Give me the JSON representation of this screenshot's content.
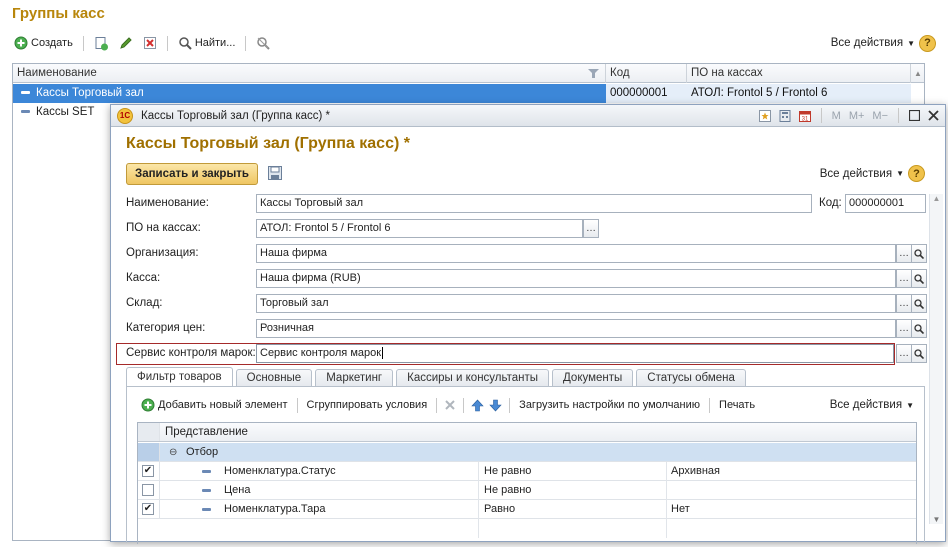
{
  "list_window": {
    "title": "Группы касс",
    "toolbar": {
      "create_label": "Создать",
      "find_label": "Найти...",
      "all_actions": "Все действия"
    },
    "columns": [
      "Наименование",
      "Код",
      "ПО на кассах"
    ],
    "rows": [
      {
        "name": "Кассы Торговый зал",
        "code": "000000001",
        "po": "АТОЛ: Frontol 5 / Frontol 6"
      },
      {
        "name": "Кассы SET",
        "code": "",
        "po": ""
      }
    ]
  },
  "form_window": {
    "window_title": "Кассы Торговый зал (Группа касс) *",
    "titlebar_buttons": [
      "M",
      "M+",
      "M−"
    ],
    "heading": "Кассы Торговый зал (Группа касс) *",
    "save_close_label": "Записать и закрыть",
    "all_actions": "Все действия",
    "fields": {
      "name": {
        "label": "Наименование:",
        "value": "Кассы Торговый зал"
      },
      "code": {
        "label": "Код:",
        "value": "000000001"
      },
      "po": {
        "label": "ПО на кассах:",
        "value": "АТОЛ: Frontol 5 / Frontol 6"
      },
      "org": {
        "label": "Организация:",
        "value": "Наша фирма"
      },
      "kassa": {
        "label": "Касса:",
        "value": "Наша фирма (RUB)"
      },
      "sklad": {
        "label": "Склад:",
        "value": "Торговый зал"
      },
      "price_cat": {
        "label": "Категория цен:",
        "value": "Розничная"
      },
      "mark_service": {
        "label": "Сервис контроля марок:",
        "value": "Сервис контроля марок"
      }
    },
    "tabs": [
      "Фильтр товаров",
      "Основные",
      "Маркетинг",
      "Кассиры и консультанты",
      "Документы",
      "Статусы обмена"
    ],
    "filter_toolbar": {
      "add_label": "Добавить новый элемент",
      "group_label": "Сгруппировать условия",
      "load_label": "Загрузить настройки по умолчанию",
      "print_label": "Печать",
      "all_actions": "Все действия"
    },
    "filter_grid": {
      "header": "Представление",
      "group_label": "Отбор",
      "rows": [
        {
          "checked": true,
          "field": "Номенклатура.Статус",
          "op": "Не равно",
          "value": "Архивная"
        },
        {
          "checked": false,
          "field": "Цена",
          "op": "Не равно",
          "value": ""
        },
        {
          "checked": true,
          "field": "Номенклатура.Тара",
          "op": "Равно",
          "value": "Нет"
        }
      ]
    }
  }
}
